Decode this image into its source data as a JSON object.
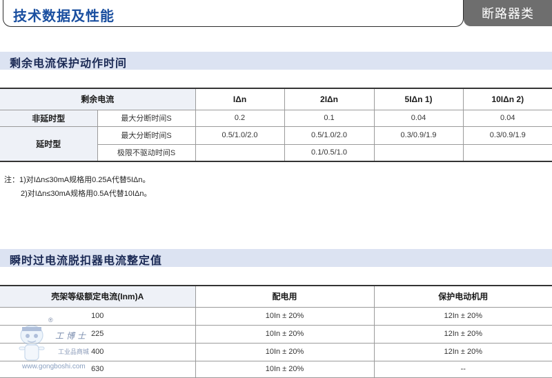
{
  "header": {
    "title": "技术数据及性能",
    "category": "断路器类"
  },
  "section1": {
    "title": "剩余电流保护动作时间",
    "col0_header": "剩余电流",
    "col_headers": [
      "IΔn",
      "2IΔn",
      "5IΔn 1)",
      "10IΔn 2)"
    ],
    "rows": [
      {
        "type": "非延时型",
        "param": "最大分断时间S",
        "values": [
          "0.2",
          "0.1",
          "0.04",
          "0.04"
        ]
      },
      {
        "type": "延时型",
        "param": "最大分断时间S",
        "values": [
          "0.5/1.0/2.0",
          "0.5/1.0/2.0",
          "0.3/0.9/1.9",
          "0.3/0.9/1.9"
        ]
      },
      {
        "type": "",
        "param": "极限不驱动时间S",
        "values": [
          "",
          "0.1/0.5/1.0",
          "",
          ""
        ]
      }
    ],
    "notes": [
      "注：1)对IΔn≤30mA规格用0.25A代替5IΔn。",
      "2)对IΔn≤30mA规格用0.5A代替10IΔn。"
    ]
  },
  "section2": {
    "title": "瞬时过电流脱扣器电流整定值",
    "headers": [
      "壳架等级额定电流(Inm)A",
      "配电用",
      "保护电动机用"
    ],
    "rows": [
      [
        "100",
        "10In ± 20%",
        "12In ± 20%"
      ],
      [
        "225",
        "10In ± 20%",
        "12In ± 20%"
      ],
      [
        "400",
        "10In ± 20%",
        "12In ± 20%"
      ],
      [
        "630",
        "10In ± 20%",
        "--"
      ]
    ]
  },
  "watermark": {
    "registered": "®",
    "name": "工博士",
    "subtitle": "工业品商城",
    "url": "www.gongboshi.com"
  }
}
